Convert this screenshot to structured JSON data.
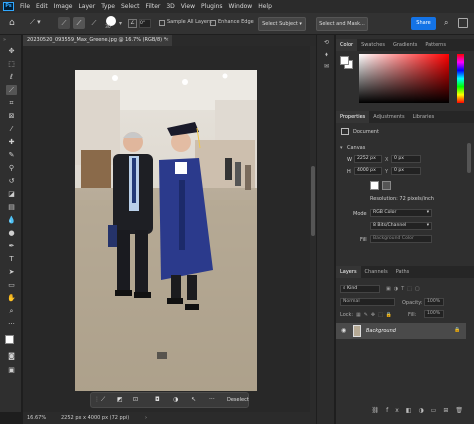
{
  "menu": {
    "logo": "Ps",
    "items": [
      "File",
      "Edit",
      "Image",
      "Layer",
      "Type",
      "Select",
      "Filter",
      "3D",
      "View",
      "Plugins",
      "Window",
      "Help"
    ]
  },
  "options_bar": {
    "brush_size": "30",
    "sample_all_layers": "Sample All Layers",
    "enhance_edge": "Enhance Edge",
    "select_subject": "Select Subject",
    "select_and_mask": "Select and Mask...",
    "share": "Share"
  },
  "document": {
    "tab_title": "20230520_093559_Max_Greene.jpg @ 16.7% (RGB/8) *"
  },
  "context_bar": {
    "deselect": "Deselect"
  },
  "status": {
    "zoom": "16.67%",
    "info": "2252 px x 4000 px (72 ppi)"
  },
  "color_panel": {
    "tabs": [
      "Color",
      "Swatches",
      "Gradients",
      "Patterns"
    ],
    "active_tab": "Color",
    "hue_color": "#ff0000"
  },
  "properties": {
    "tabs": [
      "Properties",
      "Adjustments",
      "Libraries"
    ],
    "doc_label": "Document",
    "canvas_header": "Canvas",
    "w_label": "W",
    "w_value": "2252 px",
    "h_label": "H",
    "h_value": "4000 px",
    "x_label": "X",
    "x_value": "0 px",
    "y_label": "Y",
    "y_value": "0 px",
    "resolution": "Resolution: 72 pixels/inch",
    "mode_label": "Mode",
    "mode_value": "RGB Color",
    "bits_value": "8 Bits/Channel",
    "fill_label": "Fill",
    "fill_value": "Background Color"
  },
  "layers": {
    "tabs": [
      "Layers",
      "Channels",
      "Paths"
    ],
    "kind_placeholder": "Kind",
    "blend_mode": "Normal",
    "opacity_label": "Opacity:",
    "opacity_value": "100%",
    "lock_label": "Lock:",
    "fill_label": "Fill:",
    "fill_value": "100%",
    "layer_name": "Background"
  }
}
